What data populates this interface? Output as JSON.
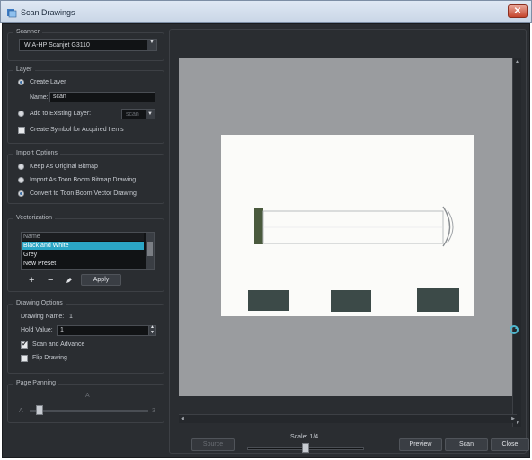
{
  "window": {
    "title": "Scan Drawings",
    "close_label": "✕"
  },
  "scanner": {
    "group_title": "Scanner",
    "selected_device": "WIA-HP Scanjet G3110"
  },
  "layer": {
    "group_title": "Layer",
    "create_layer_label": "Create Layer",
    "name_label": "Name:",
    "name_value": "scan",
    "add_existing_label": "Add to Existing Layer:",
    "existing_layer_value": "scan",
    "create_symbol_label": "Create Symbol for Acquired Items"
  },
  "import_options": {
    "group_title": "Import Options",
    "keep_original": "Keep As Original Bitmap",
    "import_bitmap": "Import As Toon Boom Bitmap Drawing",
    "convert_vector": "Convert to Toon Boom Vector Drawing"
  },
  "vectorization": {
    "group_title": "Vectorization",
    "list_header": "Name",
    "presets": [
      "Black and White",
      "Grey",
      "New Preset"
    ],
    "selected_index": 0,
    "apply_label": "Apply",
    "add_symbol": "+",
    "remove_symbol": "−"
  },
  "drawing_options": {
    "group_title": "Drawing Options",
    "drawing_name_label": "Drawing Name:",
    "drawing_name_value": "1",
    "hold_value_label": "Hold Value:",
    "hold_value": "1",
    "scan_advance_label": "Scan and Advance",
    "scan_advance_checked": true,
    "flip_drawing_label": "Flip Drawing",
    "flip_drawing_checked": false
  },
  "page_panning": {
    "group_title": "Page Panning",
    "top_marker": "A",
    "left_marker": "A",
    "right_marker": "3",
    "level": 0.05
  },
  "bottom_bar": {
    "source_label": "Source",
    "scale_label": "Scale: 1/4",
    "scale_level": 0.5,
    "preview_label": "Preview",
    "scan_label": "Scan",
    "close_label": "Close"
  },
  "colors": {
    "window_bg": "#2a2d31",
    "accent_selection": "#2ba6c6",
    "preview_bg": "#9a9c9f",
    "sheet_bg": "#fbfbf9"
  },
  "icons": {
    "app": "scan-drawings-app-icon",
    "refresh": "refresh-icon",
    "pencil": "pencil-icon"
  }
}
